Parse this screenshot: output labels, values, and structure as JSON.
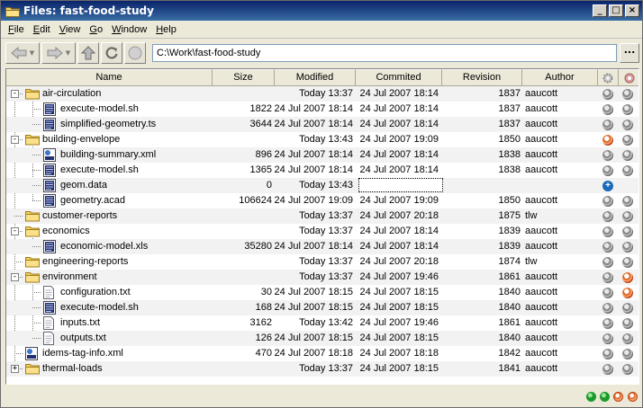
{
  "window": {
    "title": "Files: fast-food-study"
  },
  "menu": [
    {
      "label": "File",
      "key": "F",
      "rest": "ile"
    },
    {
      "label": "Edit",
      "key": "E",
      "rest": "dit"
    },
    {
      "label": "View",
      "key": "V",
      "rest": "iew"
    },
    {
      "label": "Go",
      "key": "G",
      "rest": "o"
    },
    {
      "label": "Window",
      "key": "W",
      "rest": "indow"
    },
    {
      "label": "Help",
      "key": "H",
      "rest": "elp"
    }
  ],
  "toolbar": {
    "path": "C:\\Work\\fast-food-study",
    "browse_label": "..."
  },
  "columns": {
    "name": "Name",
    "size": "Size",
    "modified": "Modified",
    "committed": "Commited",
    "revision": "Revision",
    "author": "Author"
  },
  "rows": [
    {
      "name": "air-circulation",
      "type": "folder",
      "level": 0,
      "expander": "-",
      "size": "",
      "modified": "Today 13:37",
      "committed": "24 Jul 2007 18:14",
      "revision": "1837",
      "author": "aaucott",
      "s1": "grey",
      "s2": "grey"
    },
    {
      "name": "execute-model.sh",
      "type": "sh",
      "level": 1,
      "size": "1822",
      "modified": "24 Jul 2007 18:14",
      "committed": "24 Jul 2007 18:14",
      "revision": "1837",
      "author": "aaucott",
      "s1": "grey",
      "s2": "grey"
    },
    {
      "name": "simplified-geometry.ts",
      "type": "sh",
      "level": 1,
      "size": "3644",
      "modified": "24 Jul 2007 18:14",
      "committed": "24 Jul 2007 18:14",
      "revision": "1837",
      "author": "aaucott",
      "s1": "grey",
      "s2": "grey"
    },
    {
      "name": "building-envelope",
      "type": "folder",
      "level": 0,
      "expander": "-",
      "size": "",
      "modified": "Today 13:43",
      "committed": "24 Jul 2007 19:09",
      "revision": "1850",
      "author": "aaucott",
      "s1": "orange",
      "s2": "grey"
    },
    {
      "name": "building-summary.xml",
      "type": "xml",
      "level": 1,
      "size": "896",
      "modified": "24 Jul 2007 18:14",
      "committed": "24 Jul 2007 18:14",
      "revision": "1838",
      "author": "aaucott",
      "s1": "grey",
      "s2": "grey"
    },
    {
      "name": "execute-model.sh",
      "type": "sh",
      "level": 1,
      "size": "1365",
      "modified": "24 Jul 2007 18:14",
      "committed": "24 Jul 2007 18:14",
      "revision": "1838",
      "author": "aaucott",
      "s1": "grey",
      "s2": "grey"
    },
    {
      "name": "geom.data",
      "type": "sh",
      "level": 1,
      "size": "0",
      "modified": "Today 13:43",
      "committed": "",
      "revision": "",
      "author": "",
      "s1": "blue",
      "s2": "",
      "editing": true
    },
    {
      "name": "geometry.acad",
      "type": "sh",
      "level": 1,
      "size": "106624",
      "modified": "24 Jul 2007 19:09",
      "committed": "24 Jul 2007 19:09",
      "revision": "1850",
      "author": "aaucott",
      "s1": "grey",
      "s2": "grey"
    },
    {
      "name": "customer-reports",
      "type": "folder",
      "level": 0,
      "size": "",
      "modified": "Today 13:37",
      "committed": "24 Jul 2007 20:18",
      "revision": "1875",
      "author": "tlw",
      "s1": "grey",
      "s2": "grey"
    },
    {
      "name": "economics",
      "type": "folder",
      "level": 0,
      "expander": "-",
      "size": "",
      "modified": "Today 13:37",
      "committed": "24 Jul 2007 18:14",
      "revision": "1839",
      "author": "aaucott",
      "s1": "grey",
      "s2": "grey"
    },
    {
      "name": "economic-model.xls",
      "type": "sh",
      "level": 1,
      "size": "35280",
      "modified": "24 Jul 2007 18:14",
      "committed": "24 Jul 2007 18:14",
      "revision": "1839",
      "author": "aaucott",
      "s1": "grey",
      "s2": "grey"
    },
    {
      "name": "engineering-reports",
      "type": "folder",
      "level": 0,
      "size": "",
      "modified": "Today 13:37",
      "committed": "24 Jul 2007 20:18",
      "revision": "1874",
      "author": "tlw",
      "s1": "grey",
      "s2": "grey"
    },
    {
      "name": "environment",
      "type": "folder",
      "level": 0,
      "expander": "-",
      "size": "",
      "modified": "Today 13:37",
      "committed": "24 Jul 2007 19:46",
      "revision": "1861",
      "author": "aaucott",
      "s1": "grey",
      "s2": "orange"
    },
    {
      "name": "configuration.txt",
      "type": "txt",
      "level": 1,
      "size": "30",
      "modified": "24 Jul 2007 18:15",
      "committed": "24 Jul 2007 18:15",
      "revision": "1840",
      "author": "aaucott",
      "s1": "grey",
      "s2": "orange"
    },
    {
      "name": "execute-model.sh",
      "type": "sh",
      "level": 1,
      "size": "168",
      "modified": "24 Jul 2007 18:15",
      "committed": "24 Jul 2007 18:15",
      "revision": "1840",
      "author": "aaucott",
      "s1": "grey",
      "s2": "grey"
    },
    {
      "name": "inputs.txt",
      "type": "txt",
      "level": 1,
      "size": "3162",
      "modified": "Today 13:42",
      "committed": "24 Jul 2007 19:46",
      "revision": "1861",
      "author": "aaucott",
      "s1": "grey",
      "s2": "grey"
    },
    {
      "name": "outputs.txt",
      "type": "txt",
      "level": 1,
      "size": "126",
      "modified": "24 Jul 2007 18:15",
      "committed": "24 Jul 2007 18:15",
      "revision": "1840",
      "author": "aaucott",
      "s1": "grey",
      "s2": "grey"
    },
    {
      "name": "idems-tag-info.xml",
      "type": "xml",
      "level": 0,
      "size": "470",
      "modified": "24 Jul 2007 18:18",
      "committed": "24 Jul 2007 18:18",
      "revision": "1842",
      "author": "aaucott",
      "s1": "grey",
      "s2": "grey"
    },
    {
      "name": "thermal-loads",
      "type": "folder",
      "level": 0,
      "expander": "+",
      "size": "",
      "modified": "Today 13:37",
      "committed": "24 Jul 2007 18:15",
      "revision": "1841",
      "author": "aaucott",
      "s1": "grey",
      "s2": "grey"
    }
  ],
  "status_indicators": [
    "green",
    "green",
    "orange",
    "orange"
  ]
}
